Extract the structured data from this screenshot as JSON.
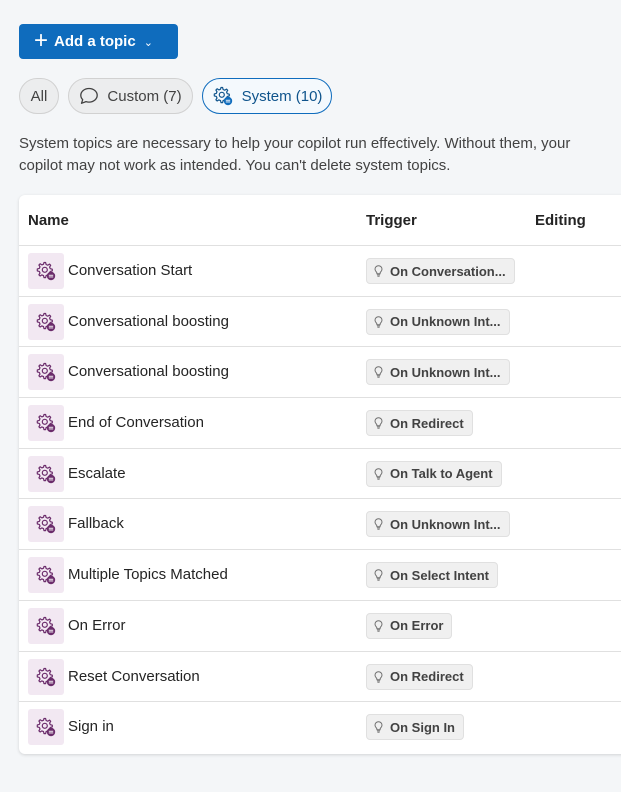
{
  "toolbar": {
    "add_topic_label": "Add a topic",
    "add_icon": "plus-icon",
    "dropdown_icon": "chevron-down-icon"
  },
  "filters": {
    "all": "All",
    "custom": "Custom (7)",
    "system": "System (10)",
    "selected": "system"
  },
  "description": "System topics are necessary to help your copilot run effectively. Without them, your copilot may not work as intended. You can't delete system topics.",
  "table": {
    "headers": {
      "name": "Name",
      "trigger": "Trigger",
      "editing": "Editing"
    },
    "rows": [
      {
        "name": "Conversation Start",
        "trigger": "On Conversation..."
      },
      {
        "name": "Conversational boosting",
        "trigger": "On Unknown Int..."
      },
      {
        "name": "Conversational boosting",
        "trigger": "On Unknown Int..."
      },
      {
        "name": "End of Conversation",
        "trigger": "On Redirect"
      },
      {
        "name": "Escalate",
        "trigger": "On Talk to Agent"
      },
      {
        "name": "Fallback",
        "trigger": "On Unknown Int..."
      },
      {
        "name": "Multiple Topics Matched",
        "trigger": "On Select Intent"
      },
      {
        "name": "On Error",
        "trigger": "On Error"
      },
      {
        "name": "Reset Conversation",
        "trigger": "On Redirect"
      },
      {
        "name": "Sign in",
        "trigger": "On Sign In"
      }
    ]
  },
  "colors": {
    "accent": "#0f6cbd",
    "system_icon": "#6b2c6b",
    "system_icon_bg": "#f2e8f2"
  }
}
